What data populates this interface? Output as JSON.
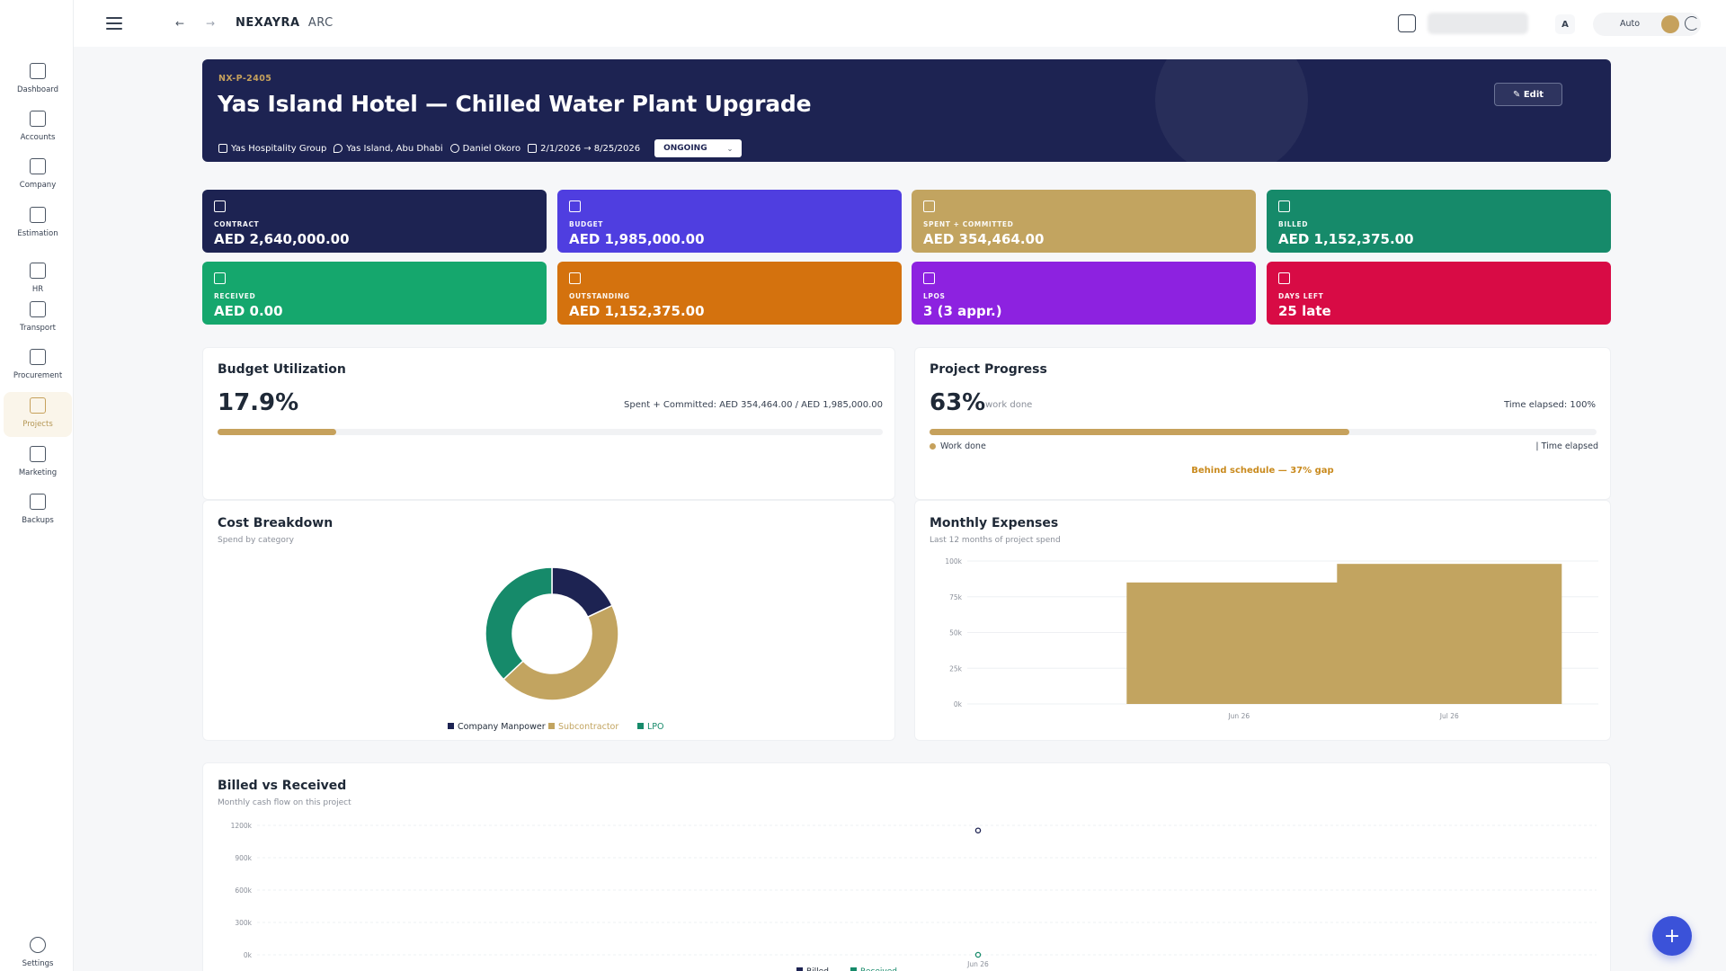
{
  "app": {
    "brand_bold": "NEXAYRA",
    "brand_light": "ARC"
  },
  "sidebar": {
    "items": [
      {
        "label": "Dashboard",
        "icon": "dashboard-icon"
      },
      {
        "label": "Accounts",
        "icon": "accounts-icon"
      },
      {
        "label": "Company",
        "icon": "company-icon"
      },
      {
        "label": "Estimation",
        "icon": "estimation-icon"
      },
      {
        "label": "HR",
        "icon": "hr-icon"
      },
      {
        "label": "Transport",
        "icon": "transport-icon"
      },
      {
        "label": "Procurement",
        "icon": "procurement-icon"
      },
      {
        "label": "Projects",
        "icon": "projects-icon",
        "active": true
      },
      {
        "label": "Marketing",
        "icon": "marketing-icon"
      },
      {
        "label": "Backups",
        "icon": "backups-icon"
      }
    ],
    "settings_label": "Settings"
  },
  "topbar": {
    "nav_back": "←",
    "nav_forward": "→",
    "avatar_initial": "A",
    "theme_label": "Auto"
  },
  "project": {
    "code": "NX-P-2405",
    "title": "Yas Island Hotel — Chilled Water Plant Upgrade",
    "client": "Yas Hospitality Group",
    "location": "Yas Island, Abu Dhabi",
    "manager": "Daniel Okoro",
    "dates": "2/1/2026 → 8/25/2026",
    "status": "ONGOING",
    "edit_label": "✎ Edit"
  },
  "stats": [
    {
      "label": "CONTRACT",
      "value": "AED 2,640,000.00",
      "color": "#1d2352"
    },
    {
      "label": "BUDGET",
      "value": "AED 1,985,000.00",
      "color": "#4f3ee0"
    },
    {
      "label": "SPENT + COMMITTED",
      "value": "AED 354,464.00",
      "color": "#c2a460"
    },
    {
      "label": "BILLED",
      "value": "AED 1,152,375.00",
      "color": "#168a6a"
    },
    {
      "label": "RECEIVED",
      "value": "AED 0.00",
      "color": "#15a76d"
    },
    {
      "label": "OUTSTANDING",
      "value": "AED 1,152,375.00",
      "color": "#d4720e"
    },
    {
      "label": "LPOS",
      "value": "3 (3 appr.)",
      "color": "#8d22e0"
    },
    {
      "label": "DAYS LEFT",
      "value": "25 late",
      "color": "#d80b45"
    }
  ],
  "budget": {
    "title": "Budget Utilization",
    "percent": "17.9%",
    "percent_value": 0.179,
    "detail": "Spent + Committed: AED 354,464.00 / AED 1,985,000.00"
  },
  "progress": {
    "title": "Project Progress",
    "percent": "63%",
    "percent_value": 0.63,
    "work_label": "work done",
    "time_elapsed": "Time elapsed: 100%",
    "time_value": 1.0,
    "legend_work": "Work done",
    "legend_time": "| Time elapsed",
    "warning": "Behind schedule — 37% gap"
  },
  "chart_data": [
    {
      "type": "pie",
      "title": "Cost Breakdown",
      "subtitle": "Spend by category",
      "categories": [
        "Company Manpower",
        "Subcontractor",
        "LPO"
      ],
      "values": [
        18,
        45,
        37
      ],
      "colors": [
        "#1d2352",
        "#c2a460",
        "#168a6a"
      ],
      "legend": "bottom"
    },
    {
      "type": "bar",
      "title": "Monthly Expenses",
      "subtitle": "Last 12 months of project spend",
      "categories": [
        "Jun 26",
        "Jul 26"
      ],
      "values": [
        85000,
        98000
      ],
      "ylim": [
        0,
        100000
      ],
      "yticks": [
        "0k",
        "25k",
        "50k",
        "75k",
        "100k"
      ],
      "color": "#c2a460",
      "grid": true
    },
    {
      "type": "line",
      "title": "Billed vs Received",
      "subtitle": "Monthly cash flow on this project",
      "x": [
        "Jun 26"
      ],
      "series": [
        {
          "name": "Billed",
          "values": [
            1152375
          ],
          "color": "#1d2352"
        },
        {
          "name": "Received",
          "values": [
            0
          ],
          "color": "#168a6a"
        }
      ],
      "ylim": [
        0,
        1200000
      ],
      "yticks": [
        "0k",
        "300k",
        "600k",
        "900k",
        "1200k"
      ],
      "legend": "bottom",
      "grid": true
    }
  ],
  "fab_label": "+"
}
